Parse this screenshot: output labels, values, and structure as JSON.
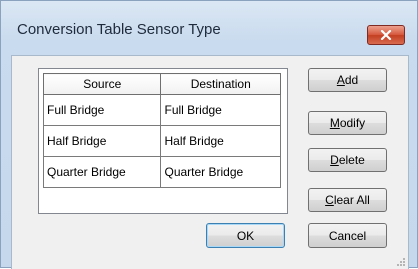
{
  "window": {
    "title": "Conversion Table Sensor Type"
  },
  "table": {
    "columns": [
      "Source",
      "Destination"
    ],
    "rows": [
      [
        "Full Bridge",
        "Full Bridge"
      ],
      [
        "Half Bridge",
        "Half Bridge"
      ],
      [
        "Quarter Bridge",
        "Quarter Bridge"
      ]
    ]
  },
  "buttons": {
    "add": {
      "mnemonic": "A",
      "rest": "dd"
    },
    "modify": {
      "mnemonic": "M",
      "rest": "odify"
    },
    "delete": {
      "mnemonic": "D",
      "rest": "elete"
    },
    "clear_all": {
      "mnemonic": "C",
      "rest": "lear All"
    },
    "ok": "OK",
    "cancel": "Cancel"
  },
  "colors": {
    "title_bar": "#c9dbee",
    "close_button": "#d65a3f",
    "default_button_border": "#3c7fb1"
  },
  "icons": {
    "close": "close-icon",
    "resize": "resize-grip-icon"
  }
}
